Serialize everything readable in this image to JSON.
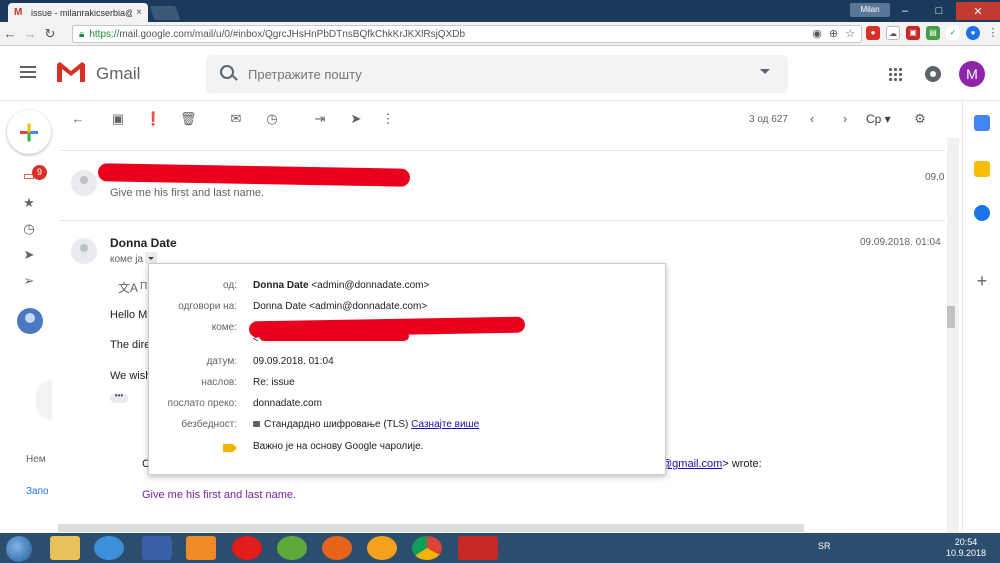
{
  "browser": {
    "tab_title": "issue - milanrakicserbia@",
    "tab_close": "×",
    "profile_label": "Milan",
    "url_secure": "https://",
    "url_rest": "mail.google.com/mail/u/0/#inbox/QgrcJHsHnPbDTnsBQfkChkKrJKXlRsjQXDb",
    "minimize": "–",
    "maximize": "□",
    "close": "✕"
  },
  "header": {
    "app_name": "Gmail",
    "search_placeholder": "Претражите пошту",
    "avatar_letter": "M"
  },
  "sidebar": {
    "inbox_badge": "9",
    "text_1": "Нем",
    "text_2": "Запо"
  },
  "toolbar": {
    "pager": "3 од 627",
    "lang": "Ср ▾"
  },
  "messages": [
    {
      "snippet": "Give me his first and last name.",
      "date": "09.0"
    },
    {
      "sender": "Donna Date",
      "date": "09.09.2018. 01:04",
      "to_me": "коме ја",
      "translate_frag": "П",
      "body_frags": [
        "Hello Mi",
        "The dire",
        "We wish"
      ],
      "ellipsis": "•••",
      "quoted_prefix": "C",
      "quoted_link": "@gmail.com",
      "quoted_suffix": "> wrote:",
      "quoted_body": "Give me his first and last name."
    }
  ],
  "details": {
    "from_label": "од:",
    "from_name": "Donna Date",
    "from_email": " <admin@donnadate.com>",
    "reply_label": "одговори на:",
    "reply_value": "Donna Date <admin@donnadate.com>",
    "to_label": "коме:",
    "to_value_frag": "<",
    "date_label": "датум:",
    "date_value": "09.09.2018. 01:04",
    "subject_label": "наслов:",
    "subject_value": "Re: issue",
    "mailedby_label": "послато преко:",
    "mailedby_value": "donnadate.com",
    "security_label": "безбедност:",
    "security_value": "Стандардно шифровање (TLS) ",
    "security_link": "Сазнајте више",
    "importance_value": "Важно је на основу Google чаролије."
  },
  "taskbar": {
    "lang": "SR",
    "time": "20:54",
    "date": "10.9.2018"
  }
}
